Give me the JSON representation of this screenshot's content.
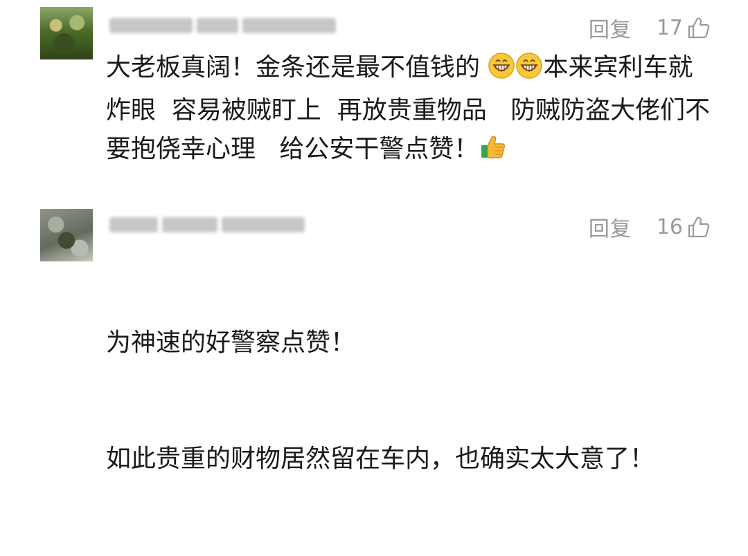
{
  "comments": [
    {
      "reply_label": "回复",
      "like_count": "17",
      "text_part1": "大老板真阔！金条还是最不值钱的 ",
      "emoji_1": "grinning-face",
      "emoji_2": "grinning-face",
      "text_part2": "本来宾利车就炸眼  容易被贼盯上  再放贵重物品   防贼防盗大佬们不要抱侥幸心理   给公安干警点赞！",
      "emoji_3": "thumbs-up"
    },
    {
      "reply_label": "回复",
      "like_count": "16",
      "line1": "为神速的好警察点赞！",
      "line2": "如此贵重的财物居然留在车内，也确实太大意了！"
    }
  ],
  "icons": {
    "like": "thumbs-up-outline-icon",
    "avatar1": "avatar-image",
    "avatar2": "avatar-image"
  },
  "colors": {
    "text": "#1a1a1a",
    "muted": "#999999"
  }
}
